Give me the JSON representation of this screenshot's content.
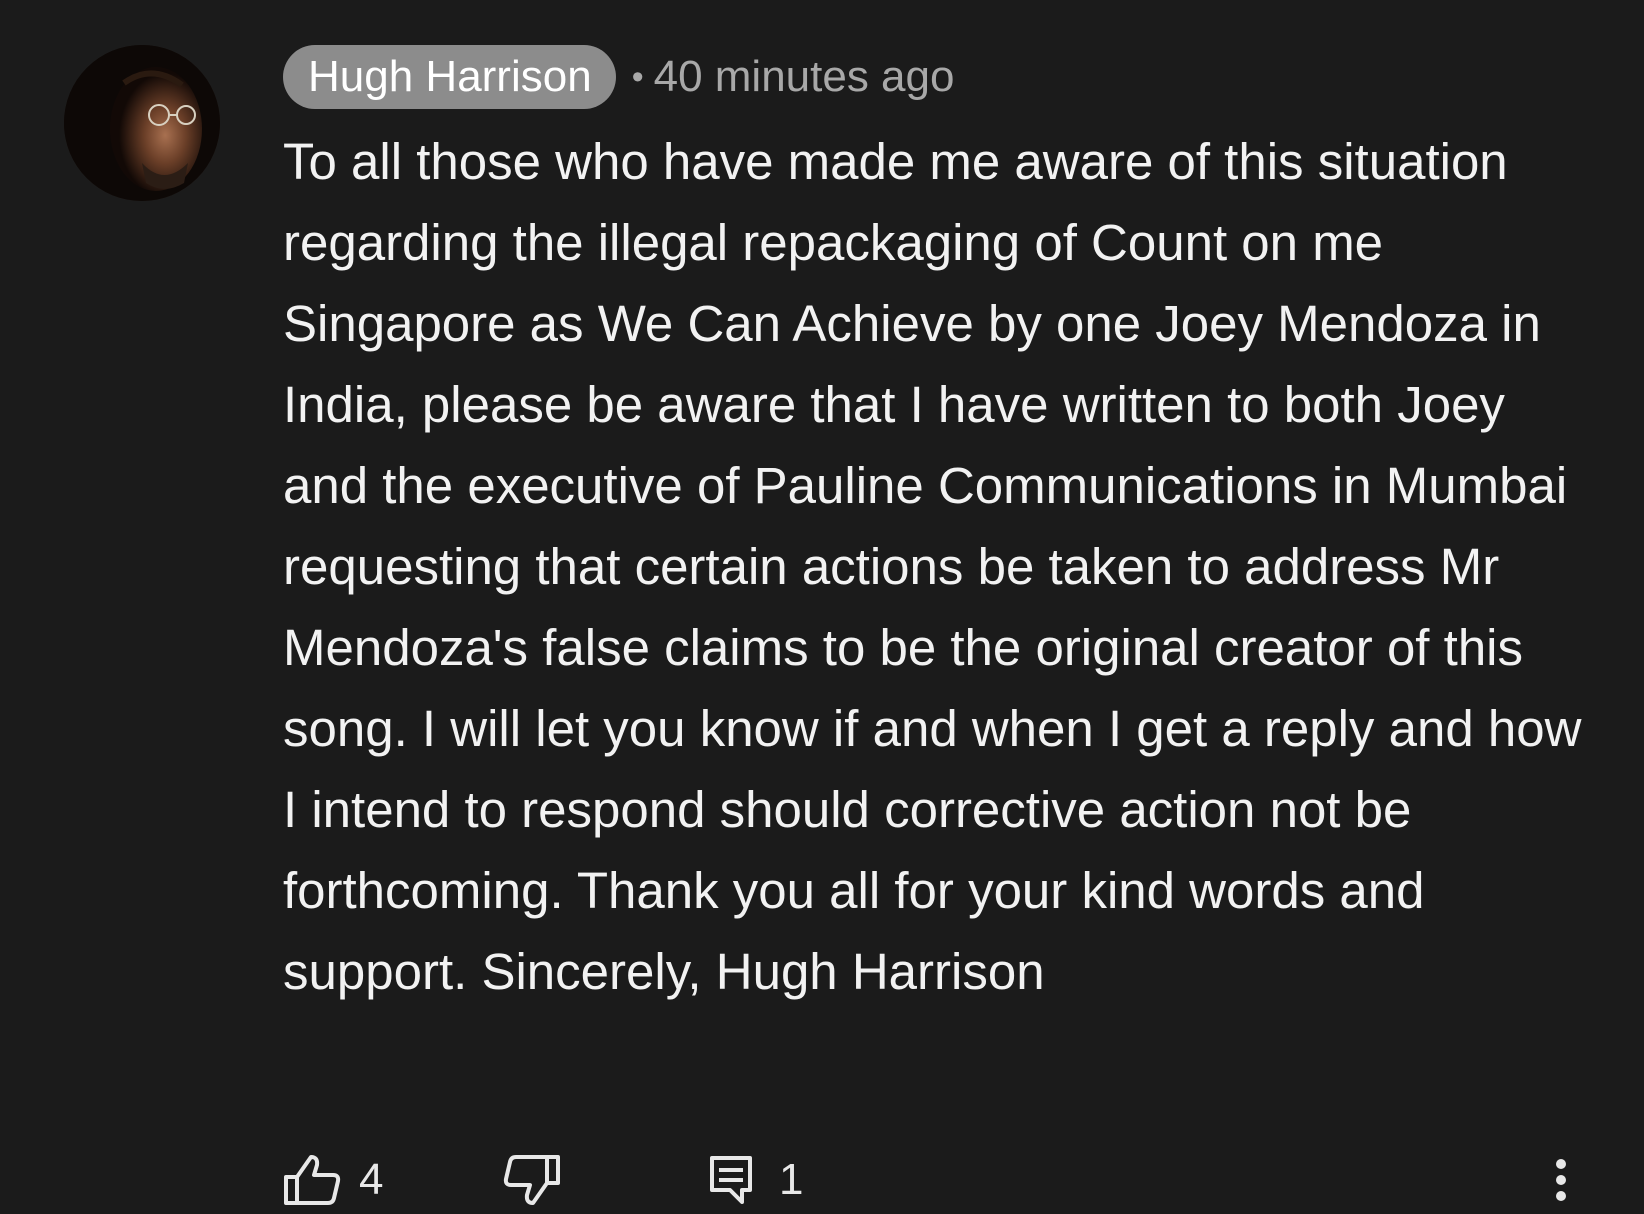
{
  "comment": {
    "author": "Hugh Harrison",
    "separator": "•",
    "timestamp": "40 minutes ago",
    "text": "To all those who have made me aware of this situation regarding the illegal repackaging of Count on me Singapore as We Can Achieve by one Joey Mendoza in India, please be aware that I have written to both Joey and the executive of Pauline Communications in Mumbai requesting that certain actions be taken to address Mr Mendoza's false claims to be the original creator of this song. I will let you know if and when I get a reply and how I intend to respond should corrective action not be forthcoming. Thank you all for your kind words and support. Sincerely, Hugh Harrison"
  },
  "actions": {
    "like_icon": "thumbs-up-icon",
    "like_count": "4",
    "dislike_icon": "thumbs-down-icon",
    "reply_icon": "comment-icon",
    "reply_count": "1",
    "more_icon": "more-vertical-icon"
  },
  "colors": {
    "background": "#1b1b1b",
    "author_chip": "#8c8c8c",
    "text": "#f2f2f2",
    "muted": "#a8a8a8"
  }
}
